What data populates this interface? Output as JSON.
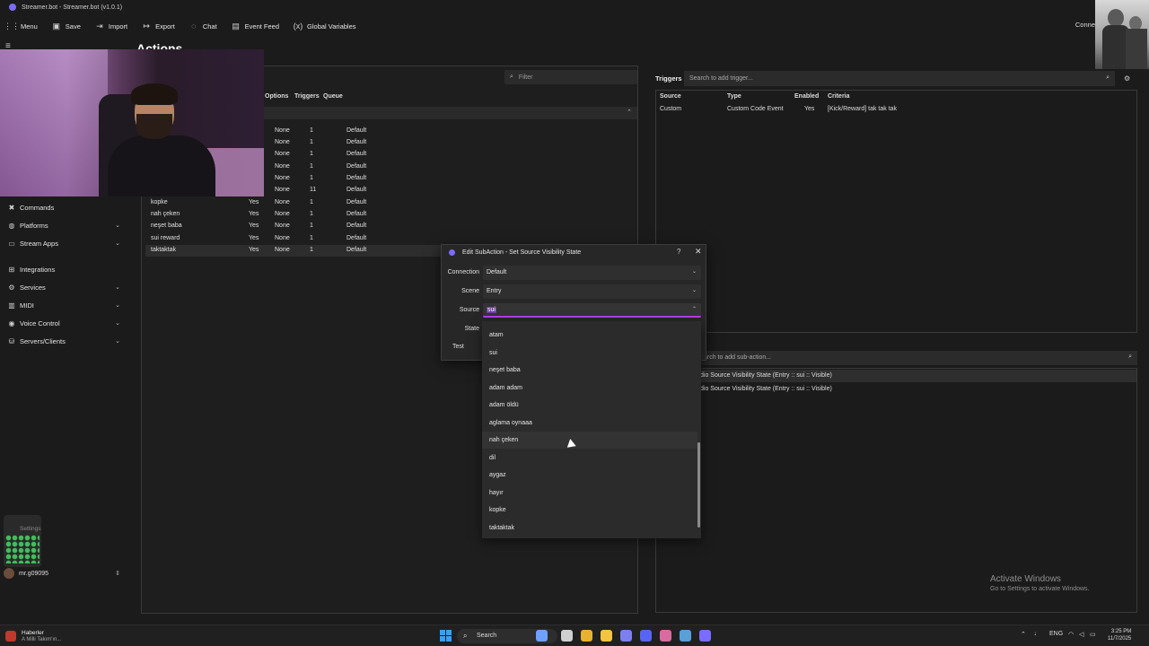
{
  "window": {
    "title": "Streamer.bot - Streamer.bot (v1.0.1)"
  },
  "menu": {
    "items": [
      {
        "icon": "grid-menu-icon",
        "glyph": "⋮⋮",
        "label": "Menu"
      },
      {
        "icon": "save-icon",
        "glyph": "▣",
        "label": "Save"
      },
      {
        "icon": "import-icon",
        "glyph": "⇥",
        "label": "Import"
      },
      {
        "icon": "export-icon",
        "glyph": "↦",
        "label": "Export"
      },
      {
        "icon": "chat-icon",
        "glyph": "◌",
        "label": "Chat"
      },
      {
        "icon": "event-feed-icon",
        "glyph": "▤",
        "label": "Event Feed"
      },
      {
        "icon": "global-variables-icon",
        "glyph": "(x)",
        "label": "Global Variables"
      }
    ],
    "right_label": "Conne"
  },
  "page_title": "Actions",
  "sidebar": {
    "items": [
      {
        "icon": "commands-icon",
        "glyph": "✖",
        "label": "Commands",
        "has_chevron": false
      },
      {
        "icon": "platforms-icon",
        "glyph": "◍",
        "label": "Platforms",
        "has_chevron": true
      },
      {
        "icon": "stream-apps-icon",
        "glyph": "▭",
        "label": "Stream Apps",
        "has_chevron": true
      },
      {
        "icon": "integrations-icon",
        "glyph": "⊞",
        "label": "Integrations",
        "has_chevron": false
      },
      {
        "icon": "services-icon",
        "glyph": "⚙",
        "label": "Services",
        "has_chevron": true
      },
      {
        "icon": "midi-icon",
        "glyph": "▥",
        "label": "MIDI",
        "has_chevron": true
      },
      {
        "icon": "voice-control-icon",
        "glyph": "◉",
        "label": "Voice Control",
        "has_chevron": true
      },
      {
        "icon": "servers-clients-icon",
        "glyph": "⛁",
        "label": "Servers/Clients",
        "has_chevron": true
      }
    ],
    "settings_label": "Settings",
    "user": "mr.g09095"
  },
  "actions": {
    "filter_placeholder": "Filter",
    "columns": [
      "Options",
      "Triggers",
      "Queue"
    ],
    "rows": [
      {
        "name": "",
        "enabled": "",
        "options": "None",
        "triggers": "1",
        "queue": "Default"
      },
      {
        "name": "",
        "enabled": "",
        "options": "None",
        "triggers": "1",
        "queue": "Default"
      },
      {
        "name": "",
        "enabled": "",
        "options": "None",
        "triggers": "1",
        "queue": "Default"
      },
      {
        "name": "",
        "enabled": "",
        "options": "None",
        "triggers": "1",
        "queue": "Default"
      },
      {
        "name": "",
        "enabled": "",
        "options": "None",
        "triggers": "1",
        "queue": "Default"
      },
      {
        "name": "",
        "enabled": "",
        "options": "None",
        "triggers": "11",
        "queue": "Default"
      },
      {
        "name": "kopke",
        "enabled": "Yes",
        "options": "None",
        "triggers": "1",
        "queue": "Default"
      },
      {
        "name": "nah çeken",
        "enabled": "Yes",
        "options": "None",
        "triggers": "1",
        "queue": "Default"
      },
      {
        "name": "neşet baba",
        "enabled": "Yes",
        "options": "None",
        "triggers": "1",
        "queue": "Default"
      },
      {
        "name": "sui reward",
        "enabled": "Yes",
        "options": "None",
        "triggers": "1",
        "queue": "Default"
      },
      {
        "name": "taktaktak",
        "enabled": "Yes",
        "options": "None",
        "triggers": "1",
        "queue": "Default"
      }
    ]
  },
  "triggers": {
    "title": "Triggers",
    "search_placeholder": "Search to add trigger...",
    "columns": [
      "Source",
      "Type",
      "Enabled",
      "Criteria"
    ],
    "row": {
      "source": "Custom",
      "type": "Custom Code Event",
      "enabled": "Yes",
      "criteria": "[Kick/Reward] tak tak tak"
    }
  },
  "subactions": {
    "search_placeholder": "arch to add sub-action...",
    "rows": [
      "dio Source Visibility State (Entry :: sui :: Visible)",
      "dio Source Visibility State (Entry :: sui :: Visible)"
    ]
  },
  "watermark": {
    "line1": "Activate Windows",
    "line2": "Go to Settings to activate Windows."
  },
  "dialog": {
    "title": "Edit SubAction - Set Source Visibility State",
    "help": "?",
    "close": "✕",
    "fields": {
      "connection_label": "Connection",
      "connection_value": "Default",
      "scene_label": "Scene",
      "scene_value": "Entry",
      "source_label": "Source",
      "source_value": "sui",
      "state_label": "State"
    },
    "test_label": "Test"
  },
  "dropdown": {
    "options": [
      "atam",
      "sui",
      "neşet baba",
      "adam adam",
      "adam öldü",
      "aglama oynaaa",
      "nah çeken",
      "dil",
      "aygaz",
      "hayır",
      "kopke",
      "taktaktak"
    ],
    "hovered": "nah çeken"
  },
  "taskbar": {
    "news_title": "Haberler",
    "news_sub": "A Milli Takım'ın...",
    "search": "Search",
    "lang": "ENG",
    "time": "3:25 PM",
    "date": "11/7/2025",
    "app_colors": [
      "#6ea0ff",
      "#d0d0d0",
      "#e8b230",
      "#f4c542",
      "#7b7ff0",
      "#5865f2",
      "#d86b9f",
      "#5aa0d8",
      "#7a6cff"
    ]
  }
}
